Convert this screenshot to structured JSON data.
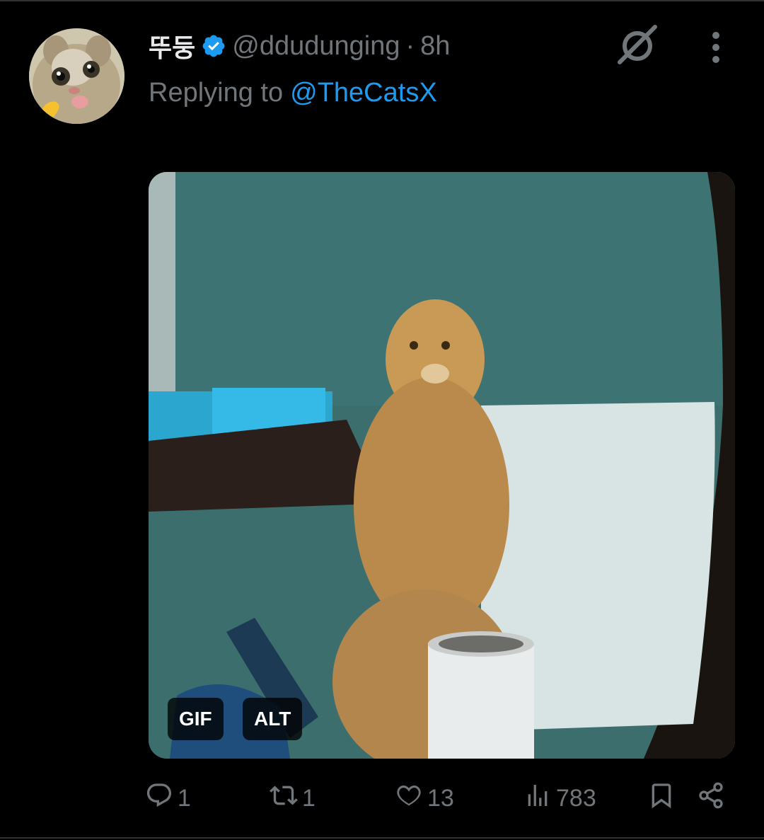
{
  "tweet": {
    "display_name": "뚜둥",
    "handle": "@ddudunging",
    "separator": "·",
    "time": "8h",
    "replying_prefix": "Replying to",
    "replying_to": "@TheCatsX",
    "verified": true
  },
  "media": {
    "type": "gif",
    "badges": {
      "gif": "GIF",
      "alt": "ALT"
    }
  },
  "actions": {
    "replies": "1",
    "reposts": "1",
    "likes": "13",
    "views": "783"
  },
  "icons": {
    "reply": "comment-icon",
    "repost": "repost-icon",
    "like": "heart-icon",
    "views": "analytics-icon",
    "bookmark": "bookmark-icon",
    "share": "share-icon",
    "grok": "grok-icon",
    "more": "more-vertical-icon"
  },
  "colors": {
    "background": "#000000",
    "text_primary": "#e7e9ea",
    "text_secondary": "#71767b",
    "accent": "#1d9bf0"
  }
}
